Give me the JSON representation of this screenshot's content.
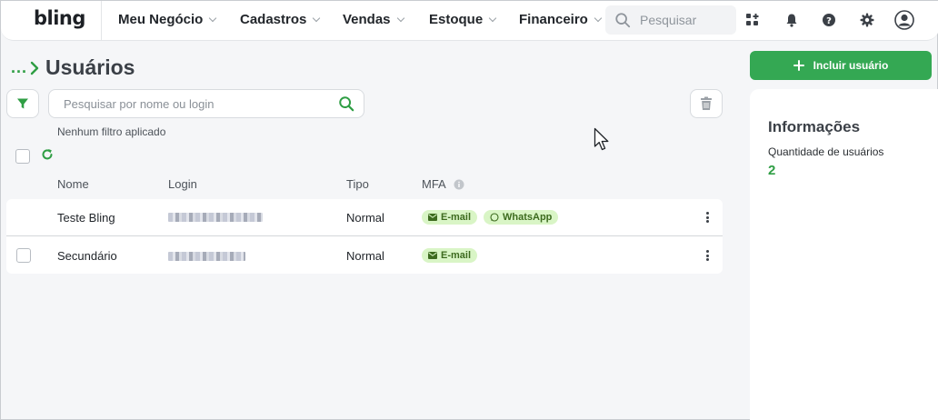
{
  "brand": {
    "logo_text": "bling"
  },
  "nav": {
    "items": [
      {
        "label": "Meu Negócio"
      },
      {
        "label": "Cadastros"
      },
      {
        "label": "Vendas"
      },
      {
        "label": "Estoque"
      },
      {
        "label": "Financeiro"
      }
    ],
    "search_placeholder": "Pesquisar",
    "icons": [
      "apps-icon",
      "bell-icon",
      "help-icon",
      "gear-icon",
      "avatar"
    ]
  },
  "page": {
    "breadcrumb_dots": "...",
    "title": "Usuários"
  },
  "toolbar": {
    "search_placeholder": "Pesquisar por nome ou login",
    "filter_status": "Nenhum filtro aplicado"
  },
  "table": {
    "columns": {
      "name": "Nome",
      "login": "Login",
      "type": "Tipo",
      "mfa": "MFA"
    },
    "rows": [
      {
        "name": "Teste Bling",
        "type": "Normal",
        "mfa": [
          "E-mail",
          "WhatsApp"
        ],
        "checkbox_visible": false
      },
      {
        "name": "Secundário",
        "type": "Normal",
        "mfa": [
          "E-mail"
        ],
        "checkbox_visible": true
      }
    ]
  },
  "actions": {
    "add_user_label": "Incluir usuário"
  },
  "info": {
    "title": "Informações",
    "user_count_label": "Quantidade de usuários",
    "user_count_value": "2"
  },
  "colors": {
    "accent": "#34a853",
    "accent_text": "#2f9e44",
    "badge_bg": "#d9f5c6",
    "badge_text": "#3d6b1f"
  }
}
